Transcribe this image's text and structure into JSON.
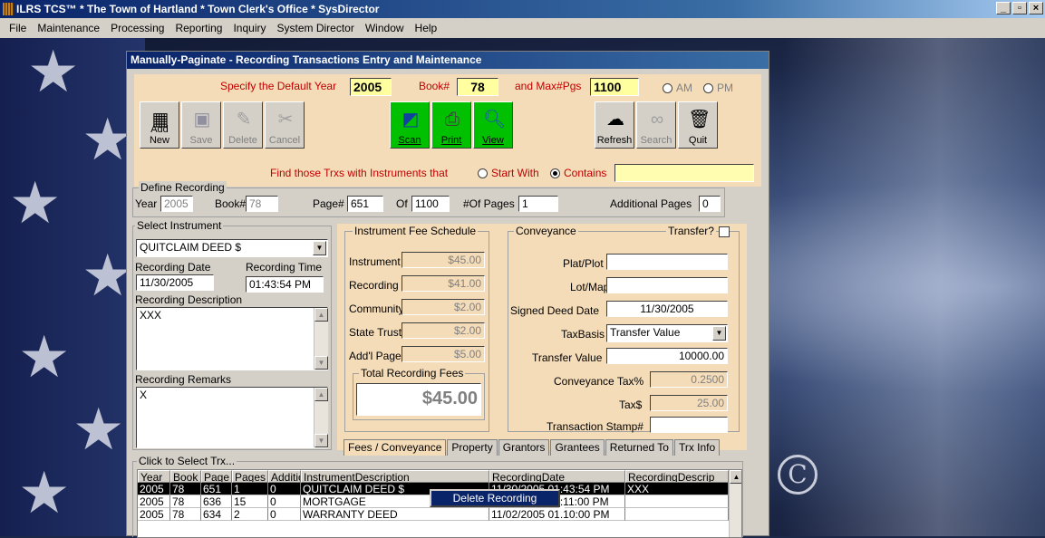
{
  "window": {
    "title": "ILRS TCS™ * The Town of Hartland * Town Clerk's Office * SysDirector",
    "controls": [
      "_",
      "3",
      "X"
    ]
  },
  "menu": [
    "File",
    "Maintenance",
    "Processing",
    "Reporting",
    "Inquiry",
    "System Director",
    "Window",
    "Help"
  ],
  "child": {
    "title": "Manually-Paginate - Recording Transactions Entry and Maintenance",
    "default_year_label": "Specify the Default Year",
    "default_year": "2005",
    "book_label": "Book#",
    "book": "78",
    "maxpgs_label": "and Max#Pgs",
    "maxpgs": "1100",
    "am_label": "AM",
    "pm_label": "PM",
    "toolbar": {
      "add_new": "Add New",
      "save": "Save",
      "delete": "Delete",
      "cancel": "Cancel",
      "scan": "Scan",
      "print": "Print",
      "view": "View",
      "refresh": "Refresh",
      "search": "Search",
      "quit": "Quit"
    },
    "find_label": "Find those Trxs with Instruments that",
    "start_with": "Start With",
    "contains": "Contains",
    "find_value": ""
  },
  "define": {
    "title": "Define Recording",
    "year_label": "Year",
    "year": "2005",
    "book_label": "Book#",
    "book": "78",
    "page_label": "Page#",
    "page": "651",
    "of_label": "Of",
    "of": "1100",
    "pages_label": "#Of Pages",
    "pages": "1",
    "addl_label": "Additional Pages",
    "addl": "0"
  },
  "instrument": {
    "title": "Select Instrument",
    "selected": "QUITCLAIM DEED $",
    "rec_date_label": "Recording Date",
    "rec_date": "11/30/2005",
    "rec_time_label": "Recording Time",
    "rec_time": "01:43:54 PM",
    "desc_label": "Recording Description",
    "desc": "XXX",
    "remarks_label": "Recording Remarks",
    "remarks": "X"
  },
  "fees": {
    "title": "Instrument Fee Schedule",
    "instrument_label": "Instrument",
    "instrument": "$45.00",
    "recording_label": "Recording",
    "recording": "$41.00",
    "community_label": "Community",
    "community": "$2.00",
    "state_trust_label": "State Trust",
    "state_trust": "$2.00",
    "addl_page_label": "Add'l Page",
    "addl_page": "$5.00",
    "total_label": "Total Recording Fees",
    "total": "$45.00"
  },
  "conveyance": {
    "title": "Conveyance",
    "transfer_label": "Transfer?",
    "plat_label": "Plat/Plot",
    "plat": "",
    "lot_label": "Lot/Map",
    "lot": "",
    "signed_label": "Signed Deed Date",
    "signed": "11/30/2005",
    "taxbasis_label": "TaxBasis",
    "taxbasis": "Transfer Value",
    "transfer_value_label": "Transfer Value",
    "transfer_value": "10000.00",
    "conv_tax_label": "Conveyance Tax%",
    "conv_tax": "0.2500",
    "tax_label": "Tax$",
    "tax": "25.00",
    "stamp_label": "Transaction Stamp#",
    "stamp": ""
  },
  "tabs": [
    "Fees / Conveyance",
    "Property",
    "Grantors",
    "Grantees",
    "Returned To",
    "Trx Info"
  ],
  "grid": {
    "title": "Click to Select Trx...",
    "headers": [
      "Year",
      "Book",
      "Page",
      "Pages",
      "Additio",
      "InstrumentDescription",
      "RecordingDate",
      "RecordingDescrip"
    ],
    "rows": [
      [
        "2005",
        "78",
        "651",
        "1",
        "0",
        "QUITCLAIM DEED $",
        "11/30/2005 01:43:54 PM",
        "XXX"
      ],
      [
        "2005",
        "78",
        "636",
        "15",
        "0",
        "MORTGAGE",
        "11/02/2005 01:11:00 PM",
        ""
      ],
      [
        "2005",
        "78",
        "634",
        "2",
        "0",
        "WARRANTY DEED",
        "11/02/2005 01:10:00 PM",
        ""
      ]
    ]
  },
  "context_menu": {
    "item": "Delete Recording"
  }
}
